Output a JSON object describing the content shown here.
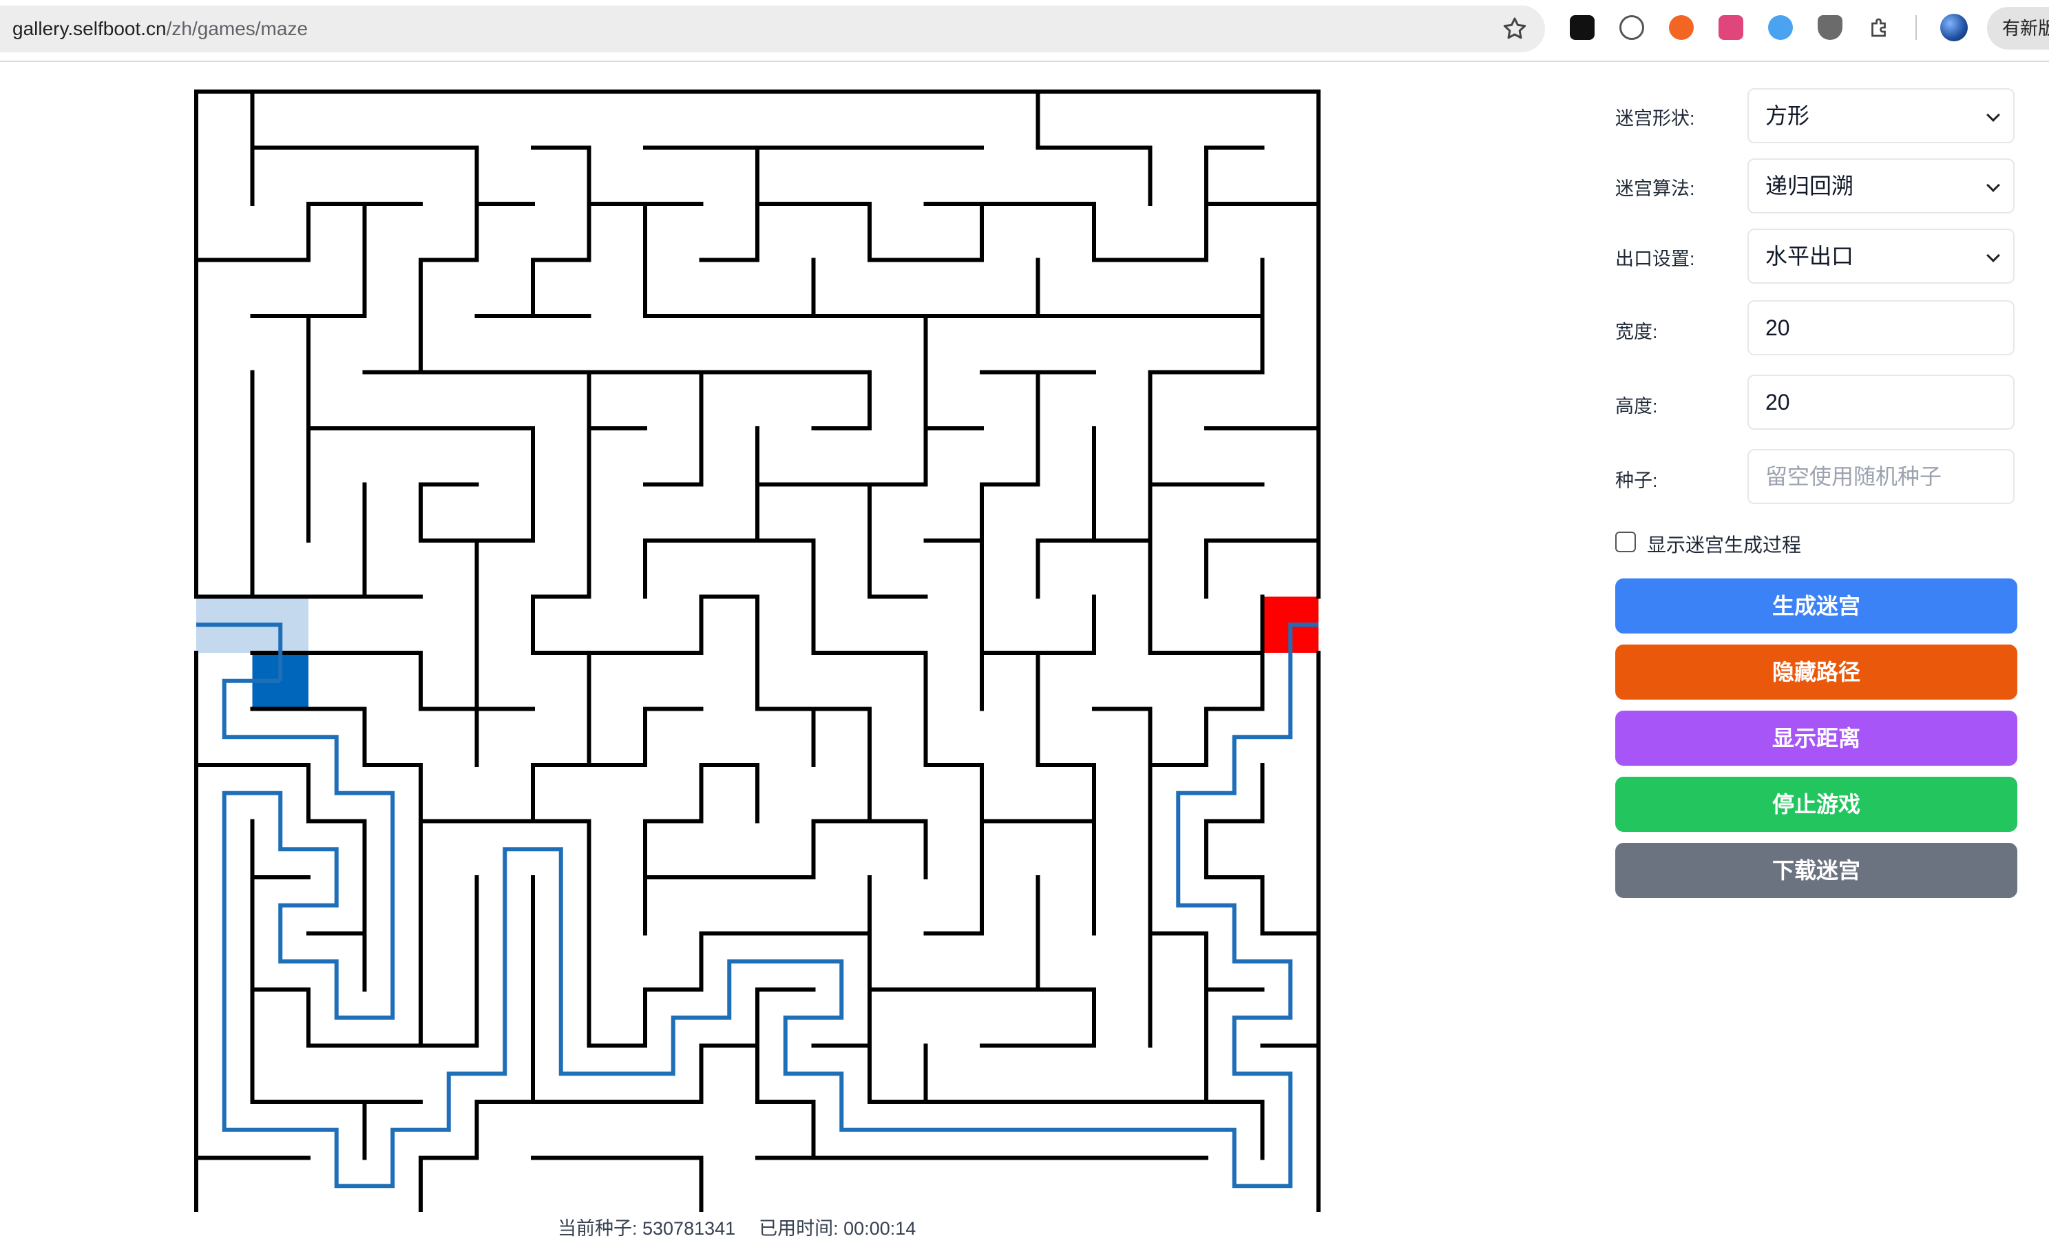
{
  "browser": {
    "url_host": "gallery.selfboot.cn",
    "url_path": "/zh/games/maze",
    "update_label": "有新版"
  },
  "maze": {
    "cols": 20,
    "rows": 20,
    "start_color": "#0066bb",
    "start_trail_color": "#c4d9ee",
    "exit_color": "#ff0000",
    "path_color": "#1f6fb8",
    "wall_color": "#000000"
  },
  "status": {
    "seed_text": "当前种子: 530781341",
    "time_text": "已用时间: 00:00:14"
  },
  "controls": {
    "shape": {
      "label": "迷宫形状:",
      "value": "方形"
    },
    "algorithm": {
      "label": "迷宫算法:",
      "value": "递归回溯"
    },
    "exit": {
      "label": "出口设置:",
      "value": "水平出口"
    },
    "width": {
      "label": "宽度:",
      "value": "20"
    },
    "height": {
      "label": "高度:",
      "value": "20"
    },
    "seed": {
      "label": "种子:",
      "placeholder": "留空使用随机种子"
    },
    "show_process": {
      "label": "显示迷宫生成过程",
      "checked": false
    }
  },
  "buttons": [
    {
      "label": "生成迷宫",
      "color": "#3b82f6"
    },
    {
      "label": "隐藏路径",
      "color": "#ea580c"
    },
    {
      "label": "显示距离",
      "color": "#a855f7"
    },
    {
      "label": "停止游戏",
      "color": "#22c55e"
    },
    {
      "label": "下载迷宫",
      "color": "#6b7280"
    }
  ]
}
